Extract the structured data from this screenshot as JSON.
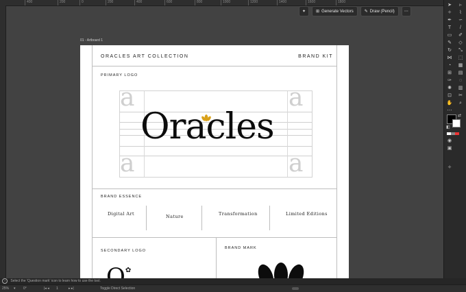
{
  "ruler": {
    "ticks": [
      "400",
      "200",
      "0",
      "200",
      "400",
      "600",
      "800",
      "1000",
      "1200",
      "1400",
      "1600",
      "1800"
    ]
  },
  "context_bar": {
    "generate_vectors": "Generate Vectors",
    "draw_pencil": "Draw (Pencil)"
  },
  "artboard": {
    "label": "01 - Artboard 1",
    "header": {
      "left": "ORACLES ART COLLECTION",
      "right": "BRAND KIT"
    },
    "primary_logo": {
      "label": "PRIMARY LOGO",
      "logo_text": "Oracles",
      "guide_letter": "a"
    },
    "brand_essence": {
      "label": "BRAND ESSENCE",
      "items": [
        "Digital Art",
        "Nature",
        "Transformation",
        "Limited Editions"
      ]
    },
    "secondary_logo": {
      "label": "SECONDARY LOGO"
    },
    "brand_mark": {
      "label": "BRAND MARK"
    }
  },
  "status": {
    "hint": "Select the 'Question mark' icon to learn how to use the tool."
  },
  "bottom": {
    "zoom": "25%",
    "rotation": "0°",
    "artboard_num": "1",
    "tool_name": "Toggle Direct Selection"
  },
  "colors": {
    "accent_flower": "#d9a11a",
    "logo": "#0c0c0c",
    "ui_bg": "#3b3b3b"
  }
}
